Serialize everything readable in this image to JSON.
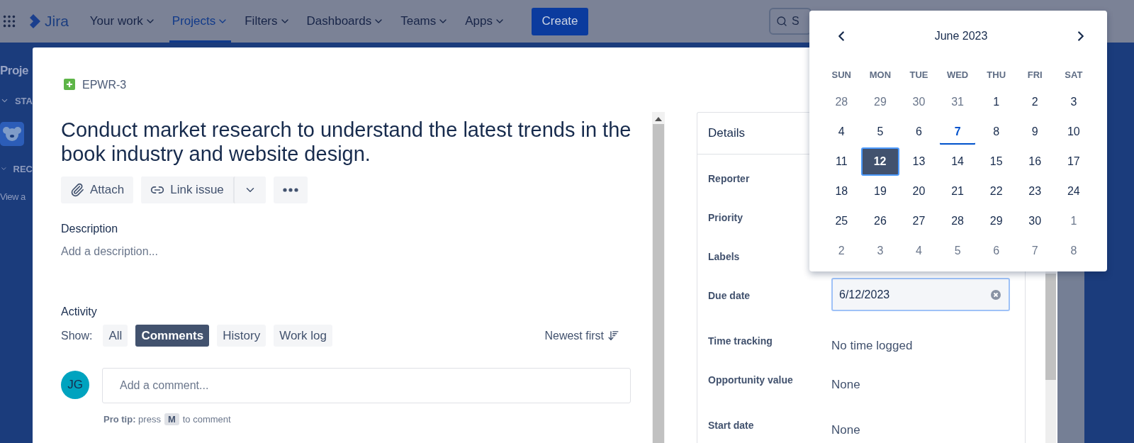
{
  "nav": {
    "product": "Jira",
    "items": [
      {
        "label": "Your work",
        "selected": false
      },
      {
        "label": "Projects",
        "selected": true
      },
      {
        "label": "Filters",
        "selected": false
      },
      {
        "label": "Dashboards",
        "selected": false
      },
      {
        "label": "Teams",
        "selected": false
      },
      {
        "label": "Apps",
        "selected": false
      }
    ],
    "create": "Create",
    "search": {
      "placeholder": "S"
    }
  },
  "sidebar": {
    "title": "Proje",
    "sections": [
      {
        "label": "STA",
        "expanded": true
      },
      {
        "label": "REC",
        "expanded": true
      }
    ],
    "link": "View a"
  },
  "issue": {
    "key": "EPWR-3",
    "title": "Conduct market research to understand the latest trends in the book industry and website design.",
    "actions": {
      "attach": "Attach",
      "link": "Link issue"
    },
    "description": {
      "heading": "Description",
      "placeholder": "Add a description..."
    },
    "activity": {
      "heading": "Activity",
      "show_label": "Show:",
      "filters": [
        {
          "label": "All",
          "selected": false
        },
        {
          "label": "Comments",
          "selected": true
        },
        {
          "label": "History",
          "selected": false
        },
        {
          "label": "Work log",
          "selected": false
        }
      ],
      "sort": "Newest first",
      "avatar": "JG",
      "comment_placeholder": "Add a comment...",
      "tip": "**Pro tip:** press",
      "tip_key": "M",
      "tip_end": "to comment"
    }
  },
  "details": {
    "heading": "Details",
    "rows": [
      {
        "label": "Reporter",
        "kind": "blank"
      },
      {
        "label": "Priority",
        "kind": "blank"
      },
      {
        "label": "Labels",
        "kind": "blank"
      },
      {
        "label": "Due date",
        "kind": "date",
        "value": "6/12/2023"
      },
      {
        "label": "Time tracking",
        "kind": "text",
        "value": "No time logged"
      },
      {
        "label": "Opportunity value",
        "kind": "text",
        "value": "None"
      },
      {
        "label": "Start date",
        "kind": "text",
        "value": "None"
      }
    ]
  },
  "calendar": {
    "month": "June 2023",
    "weekdays": [
      "SUN",
      "MON",
      "TUE",
      "WED",
      "THU",
      "FRI",
      "SAT"
    ],
    "weeks": [
      [
        {
          "day": "28",
          "outside": true,
          "today": false,
          "selected": false
        },
        {
          "day": "29",
          "outside": true,
          "today": false,
          "selected": false
        },
        {
          "day": "30",
          "outside": true,
          "today": false,
          "selected": false
        },
        {
          "day": "31",
          "outside": true,
          "today": false,
          "selected": false
        },
        {
          "day": "1",
          "outside": false,
          "today": false,
          "selected": false
        },
        {
          "day": "2",
          "outside": false,
          "today": false,
          "selected": false
        },
        {
          "day": "3",
          "outside": false,
          "today": false,
          "selected": false
        }
      ],
      [
        {
          "day": "4",
          "outside": false,
          "today": false,
          "selected": false
        },
        {
          "day": "5",
          "outside": false,
          "today": false,
          "selected": false
        },
        {
          "day": "6",
          "outside": false,
          "today": false,
          "selected": false
        },
        {
          "day": "7",
          "outside": false,
          "today": true,
          "selected": false
        },
        {
          "day": "8",
          "outside": false,
          "today": false,
          "selected": false
        },
        {
          "day": "9",
          "outside": false,
          "today": false,
          "selected": false
        },
        {
          "day": "10",
          "outside": false,
          "today": false,
          "selected": false
        }
      ],
      [
        {
          "day": "11",
          "outside": false,
          "today": false,
          "selected": false
        },
        {
          "day": "12",
          "outside": false,
          "today": false,
          "selected": true
        },
        {
          "day": "13",
          "outside": false,
          "today": false,
          "selected": false
        },
        {
          "day": "14",
          "outside": false,
          "today": false,
          "selected": false
        },
        {
          "day": "15",
          "outside": false,
          "today": false,
          "selected": false
        },
        {
          "day": "16",
          "outside": false,
          "today": false,
          "selected": false
        },
        {
          "day": "17",
          "outside": false,
          "today": false,
          "selected": false
        }
      ],
      [
        {
          "day": "18",
          "outside": false,
          "today": false,
          "selected": false
        },
        {
          "day": "19",
          "outside": false,
          "today": false,
          "selected": false
        },
        {
          "day": "20",
          "outside": false,
          "today": false,
          "selected": false
        },
        {
          "day": "21",
          "outside": false,
          "today": false,
          "selected": false
        },
        {
          "day": "22",
          "outside": false,
          "today": false,
          "selected": false
        },
        {
          "day": "23",
          "outside": false,
          "today": false,
          "selected": false
        },
        {
          "day": "24",
          "outside": false,
          "today": false,
          "selected": false
        }
      ],
      [
        {
          "day": "25",
          "outside": false,
          "today": false,
          "selected": false
        },
        {
          "day": "26",
          "outside": false,
          "today": false,
          "selected": false
        },
        {
          "day": "27",
          "outside": false,
          "today": false,
          "selected": false
        },
        {
          "day": "28",
          "outside": false,
          "today": false,
          "selected": false
        },
        {
          "day": "29",
          "outside": false,
          "today": false,
          "selected": false
        },
        {
          "day": "30",
          "outside": false,
          "today": false,
          "selected": false
        },
        {
          "day": "1",
          "outside": true,
          "today": false,
          "selected": false
        }
      ],
      [
        {
          "day": "2",
          "outside": true,
          "today": false,
          "selected": false
        },
        {
          "day": "3",
          "outside": true,
          "today": false,
          "selected": false
        },
        {
          "day": "4",
          "outside": true,
          "today": false,
          "selected": false
        },
        {
          "day": "5",
          "outside": true,
          "today": false,
          "selected": false
        },
        {
          "day": "6",
          "outside": true,
          "today": false,
          "selected": false
        },
        {
          "day": "7",
          "outside": true,
          "today": false,
          "selected": false
        },
        {
          "day": "8",
          "outside": true,
          "today": false,
          "selected": false
        }
      ]
    ]
  }
}
